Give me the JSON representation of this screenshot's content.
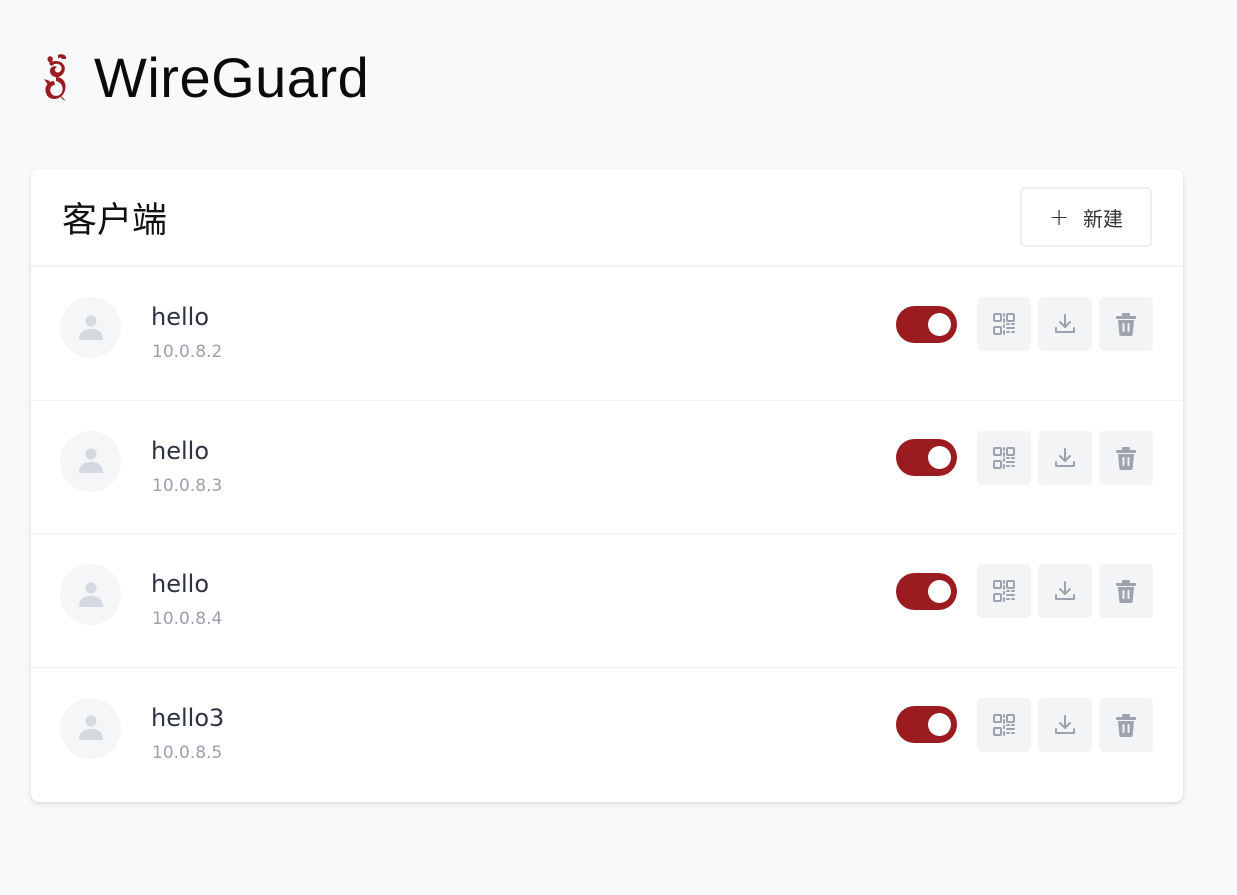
{
  "app": {
    "title": "WireGuard",
    "logo_icon": "wireguard-dragon-logo-icon"
  },
  "clients_panel": {
    "title": "客户端",
    "new_button": {
      "icon": "plus-icon",
      "label": "新建"
    }
  },
  "clients": [
    {
      "name": "hello",
      "ip": "10.0.8.2",
      "enabled": true
    },
    {
      "name": "hello",
      "ip": "10.0.8.3",
      "enabled": true
    },
    {
      "name": "hello",
      "ip": "10.0.8.4",
      "enabled": true
    },
    {
      "name": "hello3",
      "ip": "10.0.8.5",
      "enabled": true
    }
  ],
  "row_actions": [
    "qrcode-icon",
    "download-icon",
    "trash-icon"
  ],
  "colors": {
    "accent": "#9a1c20",
    "background": "#f8f9fb",
    "card": "#ffffff",
    "muted_text": "#9aa1ad",
    "icon_gray": "#9ca3af"
  }
}
